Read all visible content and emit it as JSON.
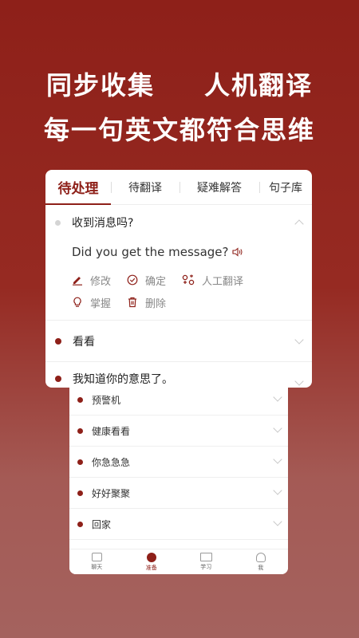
{
  "headline": {
    "line1_left": "同步收集",
    "line1_right": "人机翻译",
    "line2": "每一句英文都符合思维"
  },
  "tabs": [
    {
      "label": "待处理",
      "active": true
    },
    {
      "label": "待翻译",
      "active": false
    },
    {
      "label": "疑难解答",
      "active": false
    },
    {
      "label": "句子库",
      "active": false
    }
  ],
  "expanded_item": {
    "question": "收到消息吗?",
    "answer": "Did you get the message?",
    "actions": {
      "edit": "修改",
      "confirm": "确定",
      "manual_translate": "人工翻译",
      "master": "掌握",
      "delete": "删除"
    }
  },
  "items": [
    {
      "text": "看看"
    },
    {
      "text": "我知道你的意思了。"
    }
  ],
  "back_items": [
    {
      "text": "预警机"
    },
    {
      "text": "健康看看"
    },
    {
      "text": "你急急急"
    },
    {
      "text": "好好聚聚"
    },
    {
      "text": "回家"
    }
  ],
  "tabbar": [
    {
      "label": "聊天",
      "icon": "chat-icon",
      "active": false
    },
    {
      "label": "准备",
      "icon": "prepare-icon",
      "active": true
    },
    {
      "label": "学习",
      "icon": "book-icon",
      "active": false
    },
    {
      "label": "我",
      "icon": "user-icon",
      "active": false
    }
  ],
  "colors": {
    "brand": "#8e2019",
    "muted_icon": "#9a9a9a"
  }
}
